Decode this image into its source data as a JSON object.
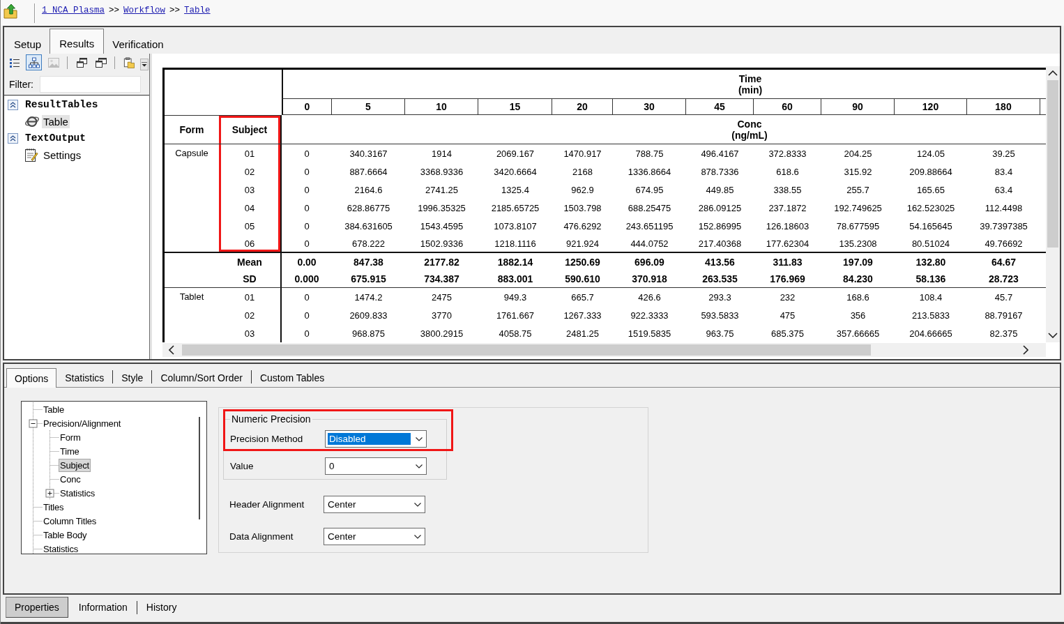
{
  "breadcrumb": [
    {
      "kind": "link",
      "text": "1 NCA Plasma"
    },
    {
      "kind": "separator",
      "text": ">>"
    },
    {
      "kind": "link",
      "text": "Workflow"
    },
    {
      "kind": "separator",
      "text": ">>"
    },
    {
      "kind": "link",
      "text": "Table"
    }
  ],
  "main_tabs": [
    {
      "label": "Setup",
      "selected": false
    },
    {
      "label": "Results",
      "selected": true
    },
    {
      "label": "Verification",
      "selected": false
    }
  ],
  "toolbar": [
    [
      {
        "kind": "list",
        "pressed": false,
        "disabled": false
      },
      {
        "kind": "tree",
        "pressed": true,
        "disabled": false
      },
      {
        "kind": "picture",
        "pressed": false,
        "disabled": true
      }
    ],
    [
      {
        "kind": "cascade",
        "pressed": false,
        "disabled": false
      },
      {
        "kind": "tile",
        "pressed": false,
        "disabled": false
      }
    ],
    [
      {
        "kind": "paste",
        "pressed": false,
        "disabled": false
      }
    ]
  ],
  "filter": {
    "label": "Filter:"
  },
  "result_tree": [
    {
      "label": "ResultTables",
      "expanded": true,
      "children": [
        {
          "label": "Table",
          "kind": "web",
          "selected": true
        }
      ]
    },
    {
      "label": "TextOutput",
      "expanded": true,
      "children": [
        {
          "label": "Settings",
          "kind": "text",
          "selected": false
        }
      ]
    }
  ],
  "table": {
    "time_title": "Time",
    "time_unit": "(min)",
    "times": [
      "0",
      "5",
      "10",
      "15",
      "20",
      "30",
      "45",
      "60",
      "90",
      "120",
      "180"
    ],
    "columns": [
      {
        "label": "Form",
        "highlighted": false
      },
      {
        "label": "Subject",
        "highlighted": true
      }
    ],
    "value_title": "Conc",
    "value_unit": "(ng/mL)",
    "groups": [
      {
        "form": "Capsule",
        "rows": [
          {
            "subject": "01",
            "values": [
              "0",
              "340.3167",
              "1914",
              "2069.167",
              "1470.917",
              "788.75",
              "496.4167",
              "372.8333",
              "204.25",
              "124.05",
              "39.25"
            ]
          },
          {
            "subject": "02",
            "values": [
              "0",
              "887.6664",
              "3368.9336",
              "3420.6664",
              "2168",
              "1336.8664",
              "878.7336",
              "618.6",
              "315.92",
              "209.88664",
              "83.4"
            ]
          },
          {
            "subject": "03",
            "values": [
              "0",
              "2164.6",
              "2741.25",
              "1325.4",
              "962.9",
              "674.95",
              "449.85",
              "338.55",
              "255.7",
              "165.65",
              "63.4"
            ]
          },
          {
            "subject": "04",
            "values": [
              "0",
              "628.86775",
              "1996.35325",
              "2185.65725",
              "1503.798",
              "688.25475",
              "286.09125",
              "237.1872",
              "192.749625",
              "162.523025",
              "112.4498"
            ]
          },
          {
            "subject": "05",
            "values": [
              "0",
              "384.631605",
              "1543.4595",
              "1073.8107",
              "476.6292",
              "243.651195",
              "152.86995",
              "126.18603",
              "78.677595",
              "54.165645",
              "39.7397385"
            ]
          },
          {
            "subject": "06",
            "values": [
              "0",
              "678.222",
              "1502.9336",
              "1218.1116",
              "921.924",
              "444.0752",
              "217.40368",
              "177.62304",
              "135.2308",
              "80.51024",
              "49.76692"
            ]
          }
        ],
        "stats": [
          {
            "label": "Mean",
            "values": [
              "0.00",
              "847.38",
              "2177.82",
              "1882.14",
              "1250.69",
              "696.09",
              "413.56",
              "311.83",
              "197.09",
              "132.80",
              "64.67"
            ]
          },
          {
            "label": "SD",
            "values": [
              "0.000",
              "675.915",
              "734.387",
              "883.001",
              "590.610",
              "370.918",
              "263.535",
              "176.969",
              "84.230",
              "58.136",
              "28.723"
            ]
          }
        ]
      },
      {
        "form": "Tablet",
        "rows": [
          {
            "subject": "01",
            "values": [
              "0",
              "1474.2",
              "2475",
              "949.3",
              "665.7",
              "426.6",
              "293.3",
              "232",
              "168.6",
              "108.4",
              "45.7"
            ]
          },
          {
            "subject": "02",
            "values": [
              "0",
              "2609.833",
              "3770",
              "1761.667",
              "1267.333",
              "922.3333",
              "593.5833",
              "475",
              "356",
              "213.5833",
              "88.79167"
            ]
          },
          {
            "subject": "03",
            "values": [
              "0",
              "968.875",
              "3800.2915",
              "4058.75",
              "2481.25",
              "1519.5835",
              "963.75",
              "685.375",
              "357.66665",
              "204.66665",
              "82.375"
            ]
          }
        ]
      }
    ]
  },
  "option_tabs": [
    {
      "label": "Options",
      "selected": true
    },
    {
      "label": "Statistics",
      "selected": false
    },
    {
      "label": "Style",
      "selected": false
    },
    {
      "label": "Column/Sort Order",
      "selected": false
    },
    {
      "label": "Custom Tables",
      "selected": false
    }
  ],
  "options_tree": [
    {
      "label": "Table",
      "selected": false
    },
    {
      "label": "Precision/Alignment",
      "selected": false,
      "expanded": true,
      "children": [
        {
          "label": "Form",
          "selected": false
        },
        {
          "label": "Time",
          "selected": false
        },
        {
          "label": "Subject",
          "selected": true
        },
        {
          "label": "Conc",
          "selected": false
        },
        {
          "label": "Statistics",
          "selected": false,
          "expanded": false
        }
      ]
    },
    {
      "label": "Titles",
      "selected": false
    },
    {
      "label": "Column Titles",
      "selected": false
    },
    {
      "label": "Table Body",
      "selected": false
    },
    {
      "label": "Statistics",
      "selected": false
    }
  ],
  "precision_group": {
    "title": "Numeric Precision",
    "highlighted": true,
    "fields": [
      {
        "label": "Precision Method",
        "value": "Disabled",
        "focused": true
      },
      {
        "label": "Value",
        "value": "0",
        "focused": false
      }
    ]
  },
  "alignment_fields": [
    {
      "label": "Header Alignment",
      "value": "Center",
      "focused": false
    },
    {
      "label": "Data Alignment",
      "value": "Center",
      "focused": false
    }
  ],
  "bottom_tabs": [
    {
      "label": "Properties",
      "selected": true
    },
    {
      "label": "Information",
      "selected": false
    },
    {
      "label": "History",
      "selected": false
    }
  ]
}
